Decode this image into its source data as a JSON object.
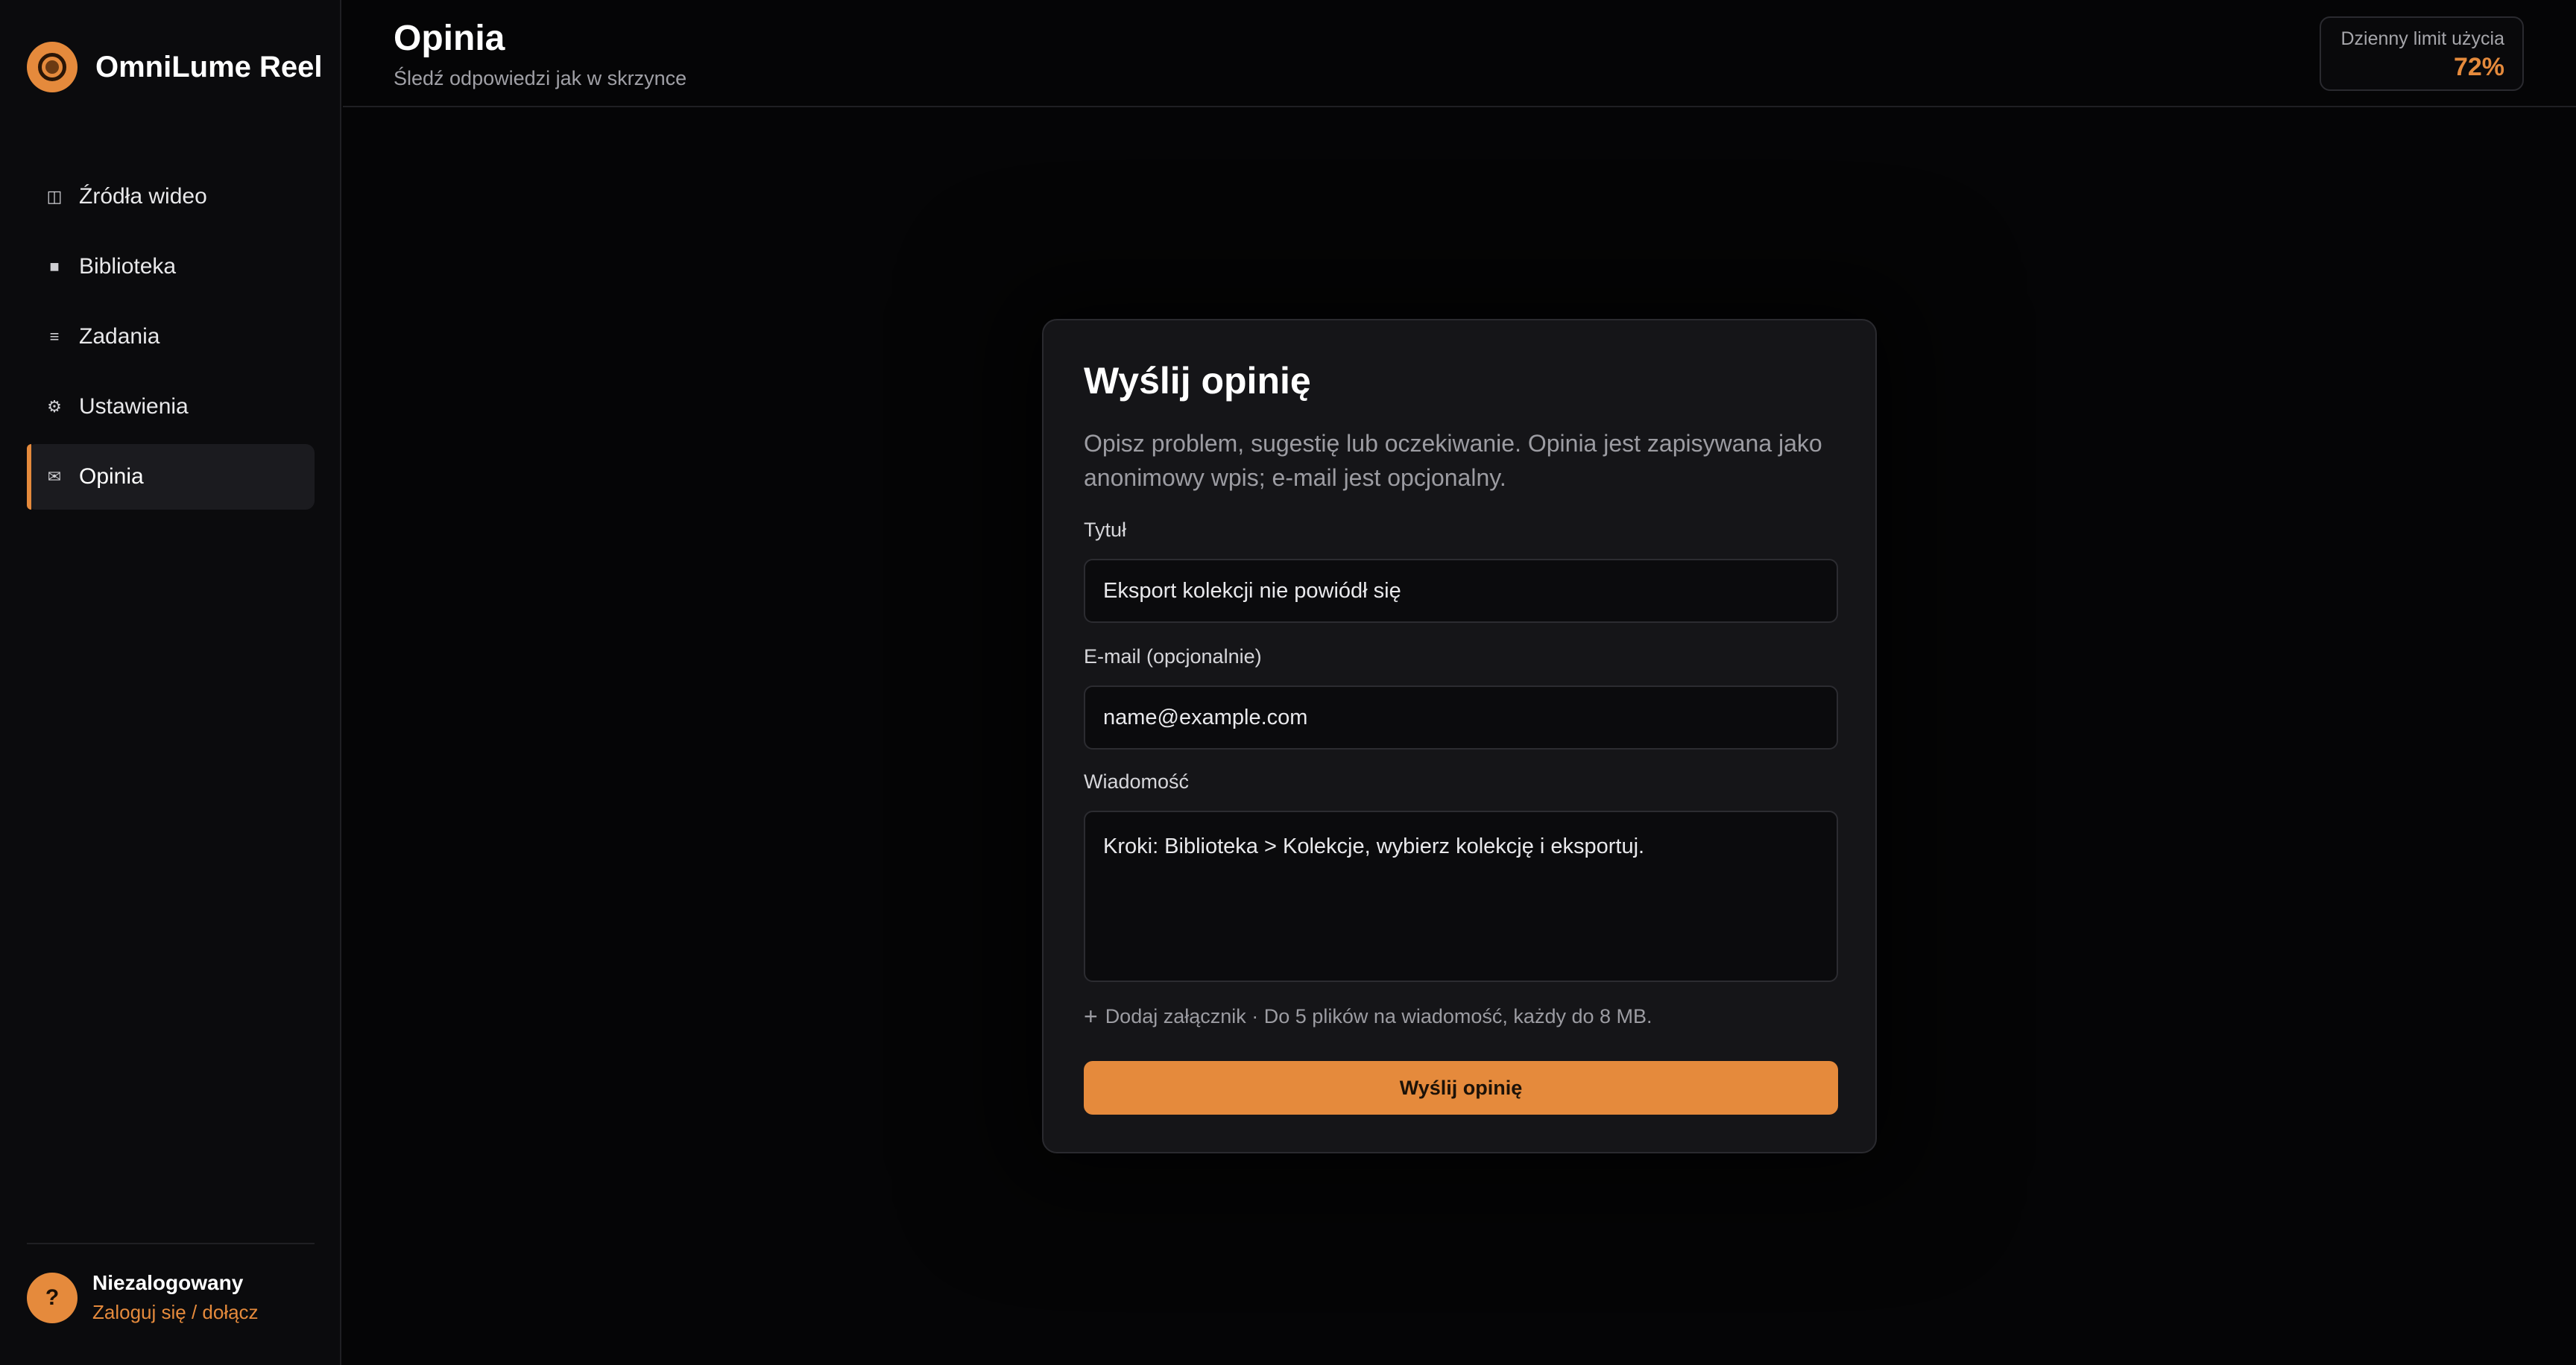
{
  "app": {
    "name": "OmniLume Reel"
  },
  "sidebar": {
    "items": [
      {
        "label": "Źródła wideo",
        "icon": "columns-icon",
        "glyph": "◫"
      },
      {
        "label": "Biblioteka",
        "icon": "library-icon",
        "glyph": "■"
      },
      {
        "label": "Zadania",
        "icon": "list-icon",
        "glyph": "≡"
      },
      {
        "label": "Ustawienia",
        "icon": "gear-icon",
        "glyph": "⚙"
      },
      {
        "label": "Opinia",
        "icon": "envelope-icon",
        "glyph": "✉",
        "active": true
      }
    ],
    "user": {
      "avatar": "?",
      "name": "Niezalogowany",
      "login_link": "Zaloguj się / dołącz"
    }
  },
  "header": {
    "title": "Opinia",
    "subtitle": "Śledź odpowiedzi jak w skrzynce",
    "usage_label": "Dzienny limit użycia",
    "usage_value": "72%"
  },
  "form": {
    "title": "Wyślij opinię",
    "description": "Opisz problem, sugestię lub oczekiwanie. Opinia jest zapisywana jako anonimowy wpis; e-mail jest opcjonalny.",
    "title_label": "Tytuł",
    "title_value": "Eksport kolekcji nie powiódł się",
    "email_label": "E-mail (opcjonalnie)",
    "email_placeholder": "name@example.com",
    "message_label": "Wiadomość",
    "message_value": "Kroki: Biblioteka > Kolekcje, wybierz kolekcję i eksportuj.",
    "attach_icon": "+",
    "attach_text": "Dodaj załącznik · Do 5 plików na wiadomość, każdy do 8 MB.",
    "submit_label": "Wyślij opinię"
  },
  "colors": {
    "accent": "#e58a3c",
    "background": "#050506",
    "sidebar": "#0b0b0d",
    "card": "#151518"
  }
}
